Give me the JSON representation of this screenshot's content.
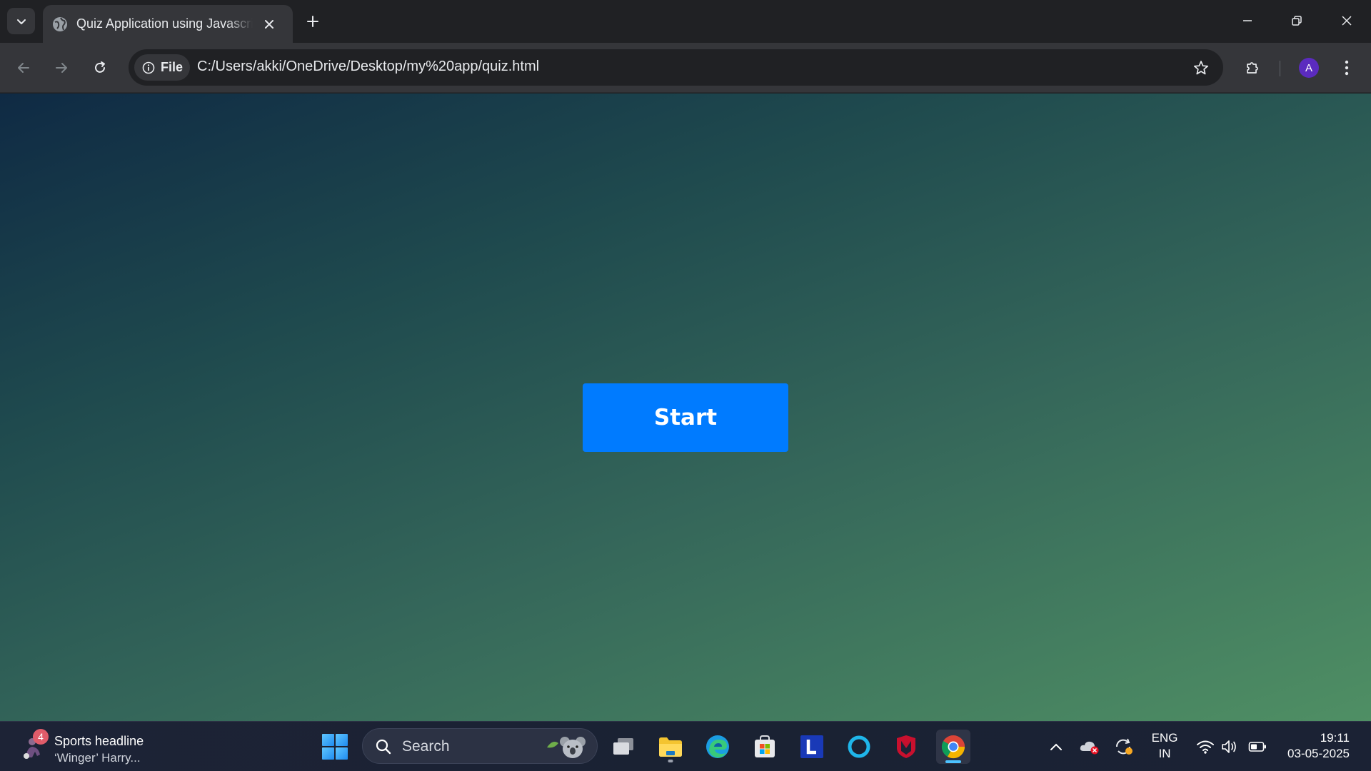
{
  "browser": {
    "tab": {
      "title": "Quiz Application using Javascript",
      "favicon": "globe-icon"
    },
    "address_bar": {
      "site_info_label": "File",
      "url": "C:/Users/akki/OneDrive/Desktop/my%20app/quiz.html"
    },
    "profile_initial": "A"
  },
  "page": {
    "start_button_label": "Start",
    "background_gradient": [
      "#0f2a44",
      "#4f8f64"
    ],
    "button_color": "#007bff"
  },
  "taskbar": {
    "widget": {
      "badge_count": "4",
      "title": "Sports headline",
      "subtitle": "‘Winger’ Harry..."
    },
    "search_label": "Search",
    "pinned_apps": [
      "task-view",
      "file-explorer",
      "edge",
      "microsoft-store",
      "l-app",
      "cortana",
      "mcafee",
      "chrome"
    ],
    "language": {
      "line1": "ENG",
      "line2": "IN"
    },
    "clock": {
      "time": "19:11",
      "date": "03-05-2025"
    }
  }
}
